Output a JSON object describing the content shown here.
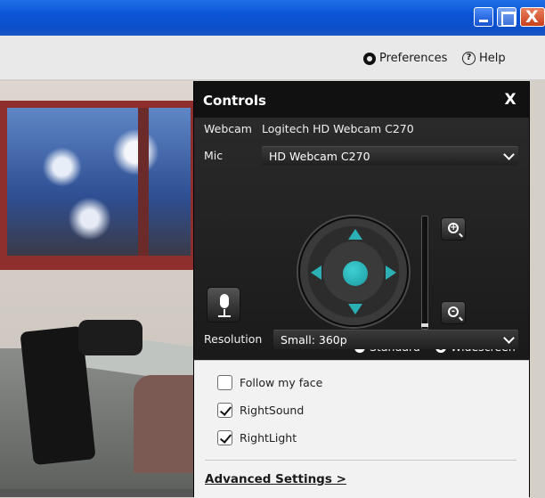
{
  "window": {
    "close_glyph": "X"
  },
  "toolbar": {
    "preferences_label": "Preferences",
    "help_label": "Help"
  },
  "controls": {
    "title": "Controls",
    "close_glyph": "X",
    "webcam_label": "Webcam",
    "webcam_value": "Logitech HD Webcam C270",
    "mic_label": "Mic",
    "mic_value": "HD Webcam C270",
    "zoom_in_glyph": "+",
    "zoom_out_glyph": "-",
    "zoom_level": 0,
    "aspect_options": [
      {
        "label": "Standard",
        "selected": false
      },
      {
        "label": "Widescreen",
        "selected": true
      }
    ],
    "resolution_label": "Resolution",
    "resolution_value": "Small: 360p",
    "checkboxes": [
      {
        "label": "Follow my face",
        "checked": false
      },
      {
        "label": "RightSound",
        "checked": true
      },
      {
        "label": "RightLight",
        "checked": true
      }
    ],
    "advanced_link": "Advanced Settings >"
  },
  "colors": {
    "accent": "#2ab0b5",
    "titlebar": "#0a54d6",
    "panel": "#1f1f1f"
  }
}
